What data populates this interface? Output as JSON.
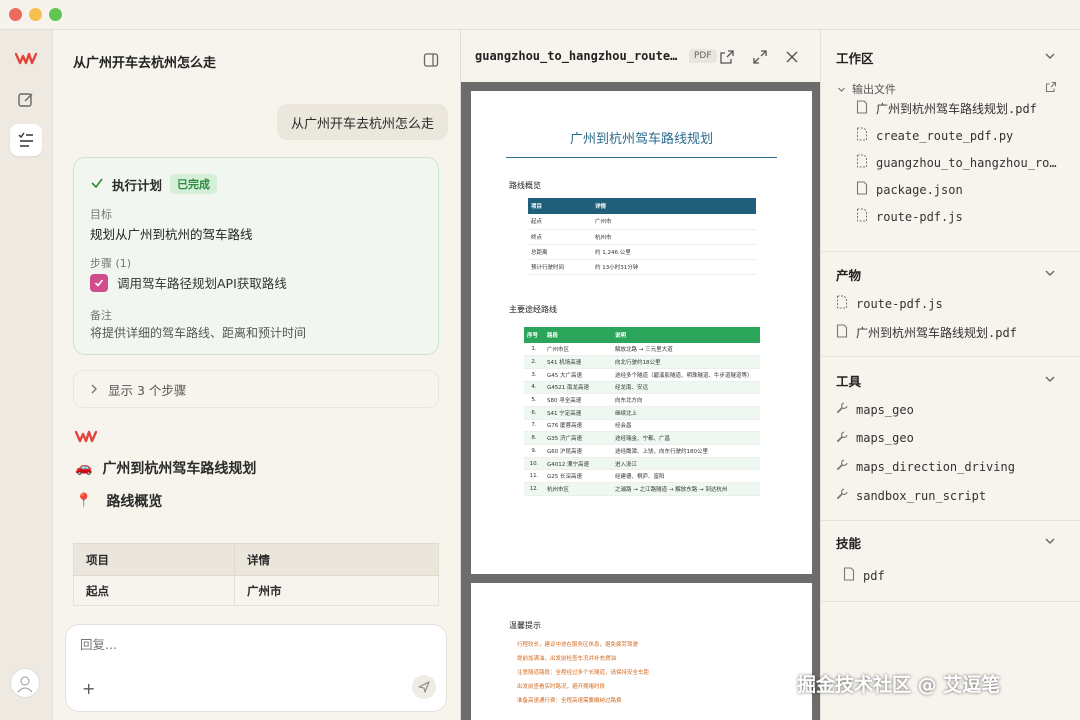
{
  "chat": {
    "title": "从广州开车去杭州怎么走",
    "user_message": "从广州开车去杭州怎么走",
    "plan": {
      "title": "执行计划",
      "status": "已完成",
      "goal_label": "目标",
      "goal": "规划从广州到杭州的驾车路线",
      "steps_label": "步骤 (1)",
      "step": "调用驾车路径规划API获取路线",
      "note_label": "备注",
      "note": "将提供详细的驾车路线、距离和预计时间"
    },
    "expander": "显示 3 个步骤",
    "route_heading": "广州到杭州驾车路线规划",
    "route_emoji": "🚗",
    "overview_heading": "路线概览",
    "overview_emoji": "📍",
    "table": {
      "headers": [
        "项目",
        "详情"
      ],
      "rows": [
        [
          "起点",
          "广州市"
        ]
      ]
    },
    "composer_placeholder": "回复..."
  },
  "preview": {
    "filename": "guangzhou_to_hangzhou_route.pdf",
    "type_chip": "PDF",
    "doc_title": "广州到杭州驾车路线规划",
    "overview_heading": "路线概览",
    "overview_table": {
      "headers": [
        "项目",
        "详情"
      ],
      "rows": [
        [
          "起点",
          "广州市"
        ],
        [
          "终点",
          "杭州市"
        ],
        [
          "总距离",
          "约 1,246 公里"
        ],
        [
          "预计行驶时间",
          "约 13小时31分钟"
        ]
      ]
    },
    "route_heading": "主要途经路线",
    "route_table": {
      "headers": [
        "序号",
        "路段",
        "说明"
      ],
      "rows": [
        [
          "1.",
          "广州市区",
          "解放北路 → 三元里大道"
        ],
        [
          "2.",
          "S41 机场高速",
          "向北行驶约18公里"
        ],
        [
          "3.",
          "G45 大广高速",
          "途经多个隧道（碧溪影隧道、明珠隧道、牛步道隧道等）"
        ],
        [
          "4.",
          "G4521 南龙高速",
          "经龙南、安远"
        ],
        [
          "5.",
          "S80 寻全高速",
          "向东北方向"
        ],
        [
          "6.",
          "S41 宁定高速",
          "继续北上"
        ],
        [
          "7.",
          "G76 厦蓉高速",
          "经会昌"
        ],
        [
          "8.",
          "G35 济广高速",
          "途经瑞金、宁都、广昌"
        ],
        [
          "9.",
          "G60 沪昆高速",
          "途经鹰潭、上饶，向东行驶约180公里"
        ],
        [
          "10.",
          "G4012 溧宁高速",
          "进入浙江"
        ],
        [
          "11.",
          "G25 长深高速",
          "经建德、桐庐、富阳"
        ],
        [
          "12.",
          "杭州市区",
          "之浦路 → 之江路隧道 → 解放东路 → 到达杭州"
        ]
      ]
    },
    "tips_heading": "温馨提示",
    "tips": [
      "行程较长，建议中途在服务区休息，避免疲劳驾驶",
      "提前加满油，出发前检查车况并补充燃油",
      "注意隧道路段：全程经过多个长隧道，请保持安全车距",
      "出发前查看实时路况，避开拥堵时段",
      "准备高速通行费：全程高速需要缴纳过路费"
    ]
  },
  "sidebar": {
    "workspace": {
      "title": "工作区",
      "folder": "输出文件",
      "files": [
        {
          "name": "广州到杭州驾车路线规划.pdf",
          "icon": "file-icon"
        },
        {
          "name": "create_route_pdf.py",
          "icon": "code-file-icon"
        },
        {
          "name": "guangzhou_to_hangzhou_route.json",
          "icon": "code-file-icon"
        },
        {
          "name": "package.json",
          "icon": "file-icon"
        },
        {
          "name": "route-pdf.js",
          "icon": "code-file-icon"
        }
      ]
    },
    "artifacts": {
      "title": "产物",
      "items": [
        "route-pdf.js",
        "广州到杭州驾车路线规划.pdf"
      ]
    },
    "tools": {
      "title": "工具",
      "items": [
        "maps_geo",
        "maps_geo",
        "maps_direction_driving",
        "sandbox_run_script"
      ]
    },
    "skills": {
      "title": "技能",
      "items": [
        "pdf"
      ]
    }
  },
  "watermark": "掘金技术社区 @ 艾逗笔",
  "colors": {
    "accent": "#d14c8c",
    "success": "#2e8b3e",
    "doc_blue": "#1f5f7a",
    "doc_green": "#2aa55a"
  }
}
